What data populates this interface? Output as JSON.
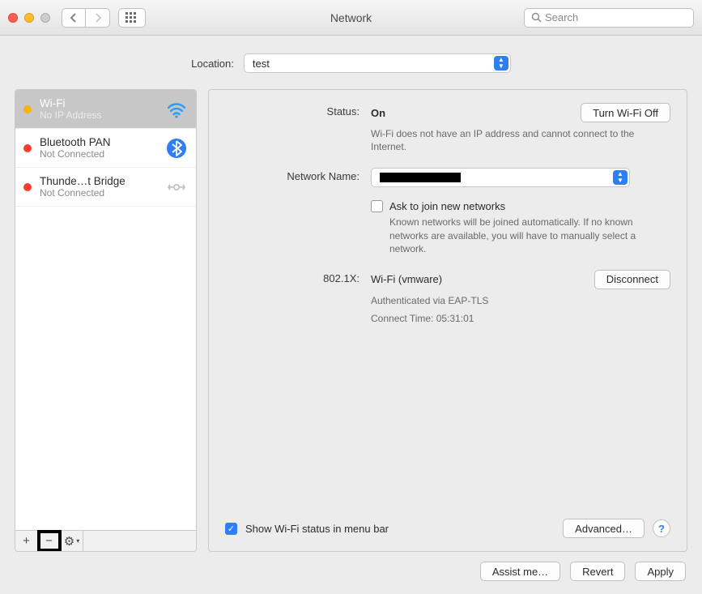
{
  "window": {
    "title": "Network"
  },
  "search": {
    "placeholder": "Search"
  },
  "location": {
    "label": "Location:",
    "value": "test"
  },
  "sidebar": {
    "items": [
      {
        "name": "Wi-Fi",
        "sub": "No IP Address",
        "dot": "#f7b500",
        "icon": "wifi",
        "selected": true
      },
      {
        "name": "Bluetooth PAN",
        "sub": "Not Connected",
        "dot": "#ff3b30",
        "icon": "bluetooth",
        "selected": false
      },
      {
        "name": "Thunde…t Bridge",
        "sub": "Not Connected",
        "dot": "#ff3b30",
        "icon": "bridge",
        "selected": false
      }
    ],
    "toolbar": {
      "add": "+",
      "remove": "−",
      "gear": "⚙︎"
    }
  },
  "status": {
    "label": "Status:",
    "value": "On",
    "button": "Turn Wi-Fi Off",
    "desc": "Wi-Fi does not have an IP address and cannot connect to the Internet."
  },
  "network_name": {
    "label": "Network Name:",
    "ask_label": "Ask to join new networks",
    "ask_checked": false,
    "ask_desc": "Known networks will be joined automatically. If no known networks are available, you will have to manually select a network."
  },
  "dot1x": {
    "label": "802.1X:",
    "value": "Wi-Fi (vmware)",
    "button": "Disconnect",
    "line1": "Authenticated via EAP-TLS",
    "line2": "Connect Time: 05:31:01"
  },
  "menubar": {
    "label": "Show Wi-Fi status in menu bar",
    "checked": true
  },
  "advanced": "Advanced…",
  "help": "?",
  "footer": {
    "assist": "Assist me…",
    "revert": "Revert",
    "apply": "Apply"
  }
}
